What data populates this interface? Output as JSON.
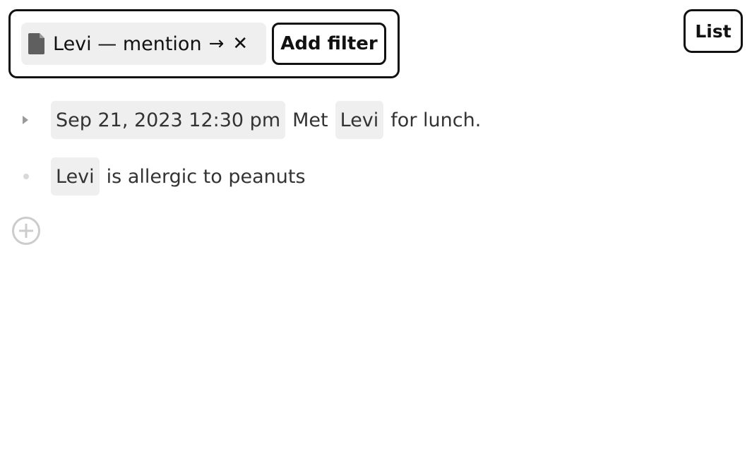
{
  "filter": {
    "chip_label": "Levi — mention",
    "arrow_glyph": "→",
    "close_glyph": "✕",
    "add_filter_label": "Add filter",
    "icon": "document-icon"
  },
  "view_toggle": {
    "label": "List"
  },
  "outline": {
    "items": [
      {
        "bullet": "caret-right-icon",
        "date_tag": "Sep 21, 2023 12:30 pm",
        "text_before": "Met",
        "mention": "Levi",
        "text_after": "for lunch."
      },
      {
        "bullet": "dot-icon",
        "mention": "Levi",
        "text_after": "is allergic to peanuts"
      }
    ],
    "add_icon": "plus-circle-icon"
  },
  "colors": {
    "tag_background": "#efefef",
    "border": "#111111",
    "text": "#333333",
    "muted_icon": "#cccccc"
  }
}
